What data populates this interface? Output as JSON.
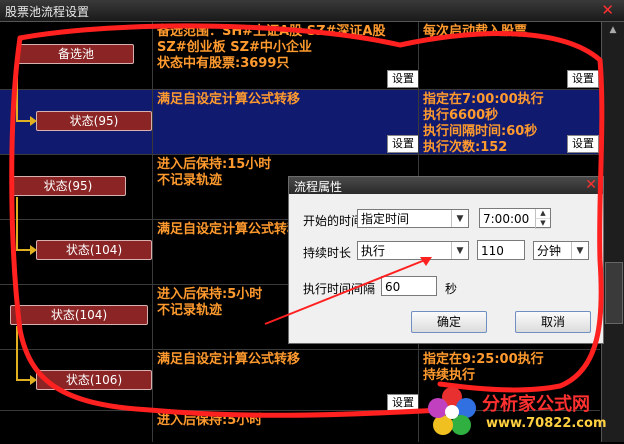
{
  "window": {
    "title": "股票池流程设置"
  },
  "colors": {
    "accent": "#ff9a2e",
    "node": "#8b2525",
    "highlight_row": "#101a6e",
    "flow_line": "#e0b020"
  },
  "set_button_label": "设置",
  "rows": [
    {
      "node": "备选池",
      "condition": "备选范围：SH#上证A股 SZ#深证A股\nSZ#创业板 SZ#中小企业\n状态中有股票:3699只",
      "action": "每次启动载入股票",
      "highlight": false
    },
    {
      "node": "状态(95)",
      "condition": "满足自设定计算公式转移",
      "action": "指定在7:00:00执行\n执行6600秒\n执行间隔时间:60秒\n执行次数:152",
      "highlight": true
    },
    {
      "node": "状态(95)",
      "condition": "进入后保持:15小时\n不记录轨迹",
      "action": "",
      "highlight": false
    },
    {
      "node": "状态(104)",
      "condition": "满足自设定计算公式转移",
      "action": "",
      "highlight": false
    },
    {
      "node": "状态(104)",
      "condition": "进入后保持:5小时\n不记录轨迹",
      "action": "",
      "highlight": false
    },
    {
      "node": "状态(106)",
      "condition": "满足自设定计算公式转移",
      "action": "指定在9:25:00执行\n持续执行",
      "highlight": false
    },
    {
      "node": "",
      "condition": "进入后保持:5小时",
      "action": "",
      "highlight": false
    }
  ],
  "dialog": {
    "title": "流程属性",
    "start_time_label": "开始的时间",
    "start_mode": "指定时间",
    "start_time": "7:00:00",
    "duration_label": "持续时长",
    "duration_mode": "执行",
    "duration_value": "110",
    "duration_unit": "分钟",
    "interval_label": "执行时间间隔",
    "interval_value": "60",
    "interval_unit": "秒",
    "ok_label": "确定",
    "cancel_label": "取消"
  },
  "watermark": {
    "name": "分析家公式网",
    "url": "www.70822.com"
  }
}
